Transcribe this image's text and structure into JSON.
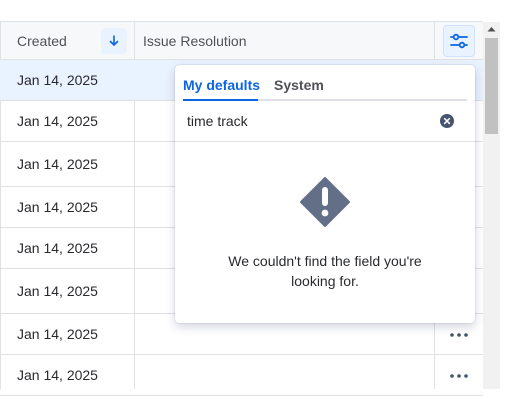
{
  "table": {
    "columns": {
      "created": "Created",
      "issue_resolution": "Issue Resolution"
    },
    "rows": [
      {
        "created": "Jan 14, 2025",
        "selected": true
      },
      {
        "created": "Jan 14, 2025",
        "selected": false
      },
      {
        "created": "Jan 14, 2025",
        "selected": false
      },
      {
        "created": "Jan 14, 2025",
        "selected": false
      },
      {
        "created": "Jan 14, 2025",
        "selected": false
      },
      {
        "created": "Jan 14, 2025",
        "selected": false
      },
      {
        "created": "Jan 14, 2025",
        "selected": false
      },
      {
        "created": "Jan 14, 2025",
        "selected": false
      }
    ]
  },
  "popup": {
    "tabs": [
      {
        "label": "My defaults",
        "active": true
      },
      {
        "label": "System",
        "active": false
      }
    ],
    "search": {
      "value": "time track"
    },
    "empty_message": "We couldn't find the field you're looking for."
  },
  "icons": {
    "sort": "arrow-down-icon",
    "settings": "sliders-icon",
    "clear": "clear-circle-icon",
    "empty_state": "warning-diamond-icon",
    "row_action": "more-horizontal-icon"
  },
  "colors": {
    "accent": "#0c66e4",
    "selected_row": "#e9f2ff",
    "icon_dark": "#44546f",
    "warning_icon": "#626f86",
    "border": "#dfe1e6"
  }
}
